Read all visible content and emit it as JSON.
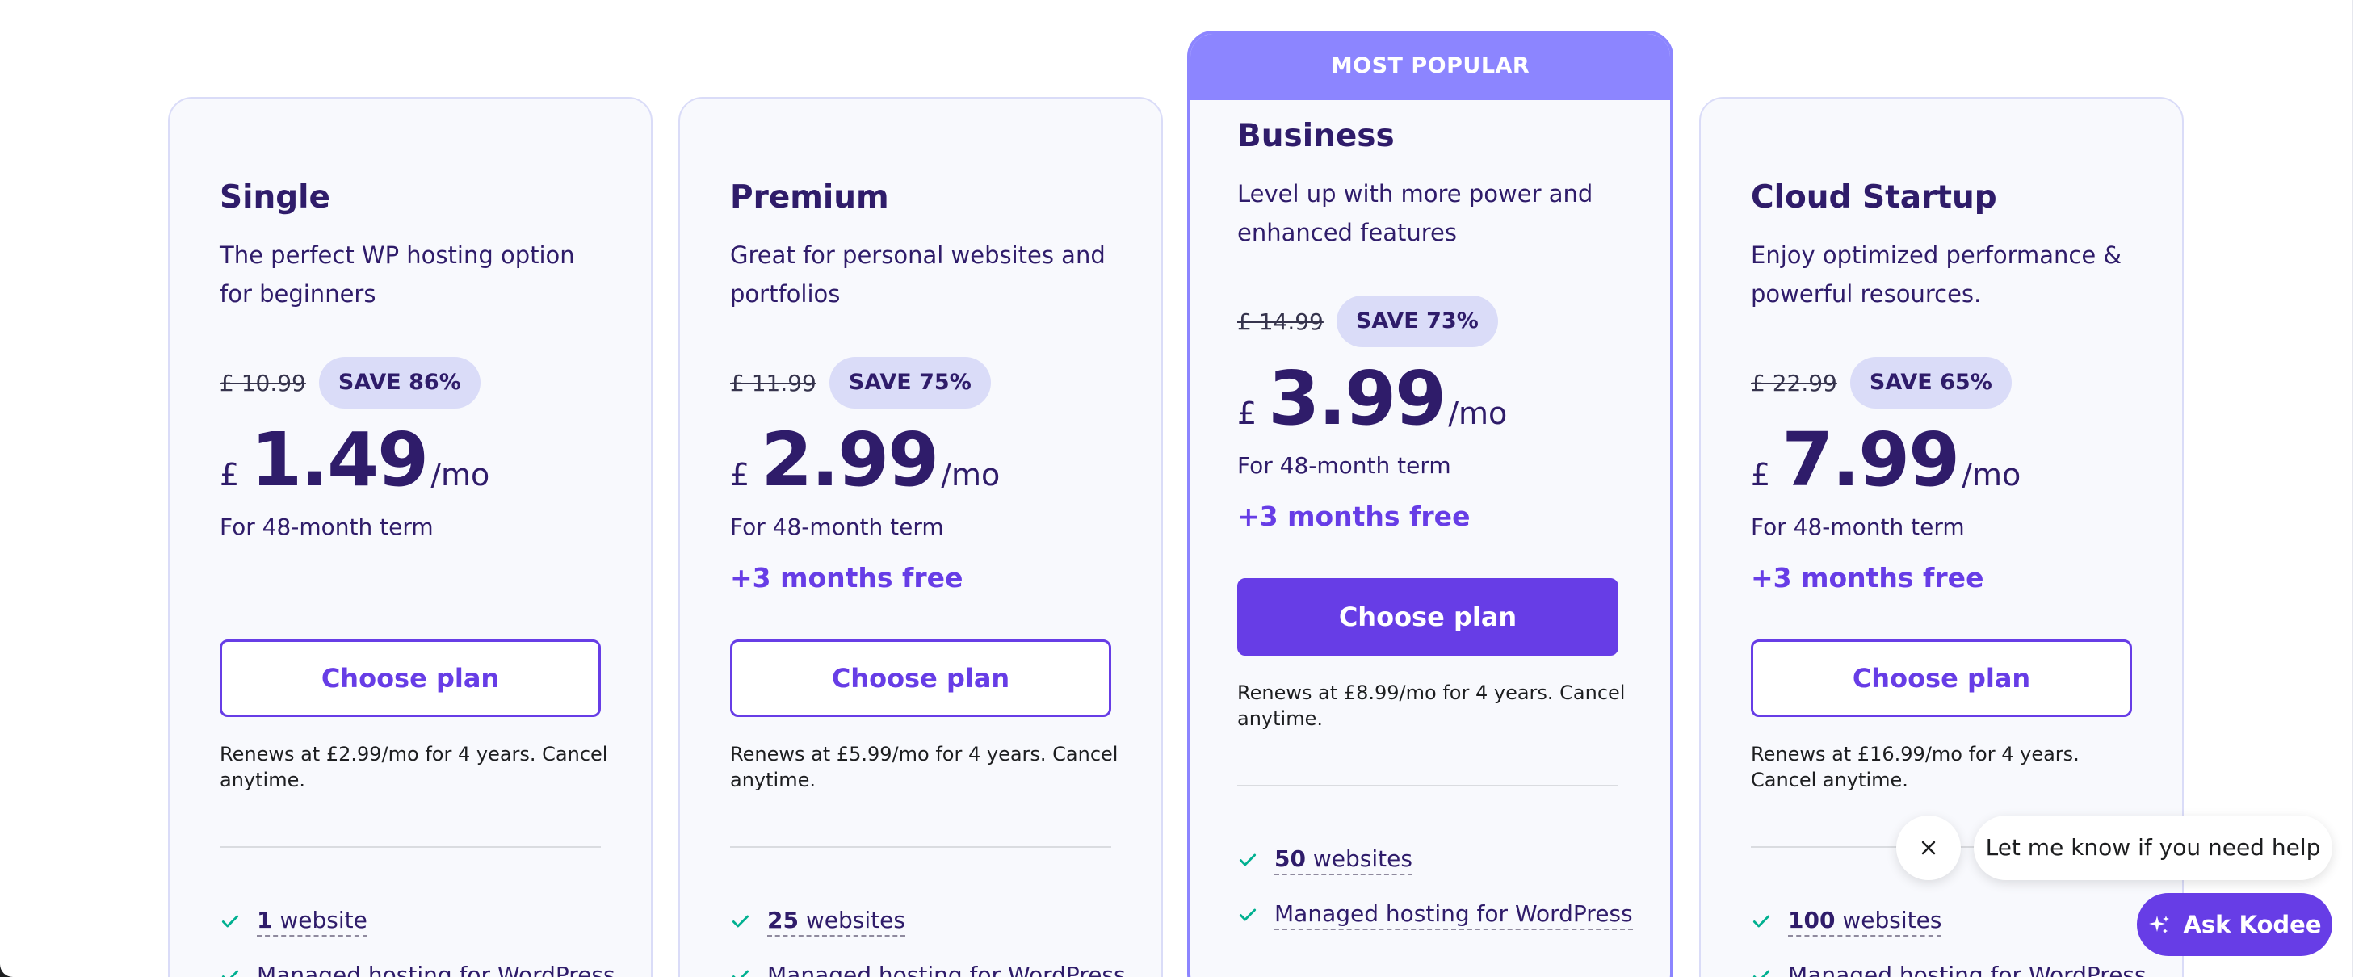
{
  "colors": {
    "accent": "#673de6",
    "popular": "#8c85ff",
    "text": "#2f1c6a",
    "badge": "#dadcf8",
    "check": "#00b090"
  },
  "plans": [
    {
      "name": "Single",
      "description": "The perfect WP hosting option for beginners",
      "old_price": "£ 10.99",
      "save": "SAVE 86%",
      "currency": "£",
      "amount": "1.49",
      "per": "/mo",
      "term": "For 48-month term",
      "free": "",
      "button": "Choose plan",
      "renew": "Renews at £2.99/mo for 4 years. Cancel anytime.",
      "features": [
        {
          "count": "1",
          "label": " website"
        },
        {
          "count": "",
          "label": "Managed hosting for WordPress"
        }
      ]
    },
    {
      "name": "Premium",
      "description": "Great for personal websites and portfolios",
      "old_price": "£ 11.99",
      "save": "SAVE 75%",
      "currency": "£",
      "amount": "2.99",
      "per": "/mo",
      "term": "For 48-month term",
      "free": "+3 months free",
      "button": "Choose plan",
      "renew": "Renews at £5.99/mo for 4 years. Cancel anytime.",
      "features": [
        {
          "count": "25",
          "label": " websites"
        },
        {
          "count": "",
          "label": "Managed hosting for WordPress"
        }
      ]
    },
    {
      "badge": "MOST POPULAR",
      "name": "Business",
      "description": "Level up with more power and enhanced features",
      "old_price": "£ 14.99",
      "save": "SAVE 73%",
      "currency": "£",
      "amount": "3.99",
      "per": "/mo",
      "term": "For 48-month term",
      "free": "+3 months free",
      "button": "Choose plan",
      "renew": "Renews at £8.99/mo for 4 years. Cancel anytime.",
      "features": [
        {
          "count": "50",
          "label": " websites"
        },
        {
          "count": "",
          "label": "Managed hosting for WordPress"
        }
      ]
    },
    {
      "name": "Cloud Startup",
      "description": "Enjoy optimized performance & powerful resources.",
      "old_price": "£ 22.99",
      "save": "SAVE 65%",
      "currency": "£",
      "amount": "7.99",
      "per": "/mo",
      "term": "For 48-month term",
      "free": "+3 months free",
      "button": "Choose plan",
      "renew": "Renews at £16.99/mo for 4 years. Cancel anytime.",
      "features": [
        {
          "count": "100",
          "label": " websites"
        },
        {
          "count": "",
          "label": "Managed hosting for WordPress"
        }
      ]
    }
  ],
  "chat": {
    "message": "Let me know if you need help",
    "ask_label": "Ask Kodee",
    "close_icon": "close-icon",
    "ask_icon": "sparkle-icon"
  }
}
